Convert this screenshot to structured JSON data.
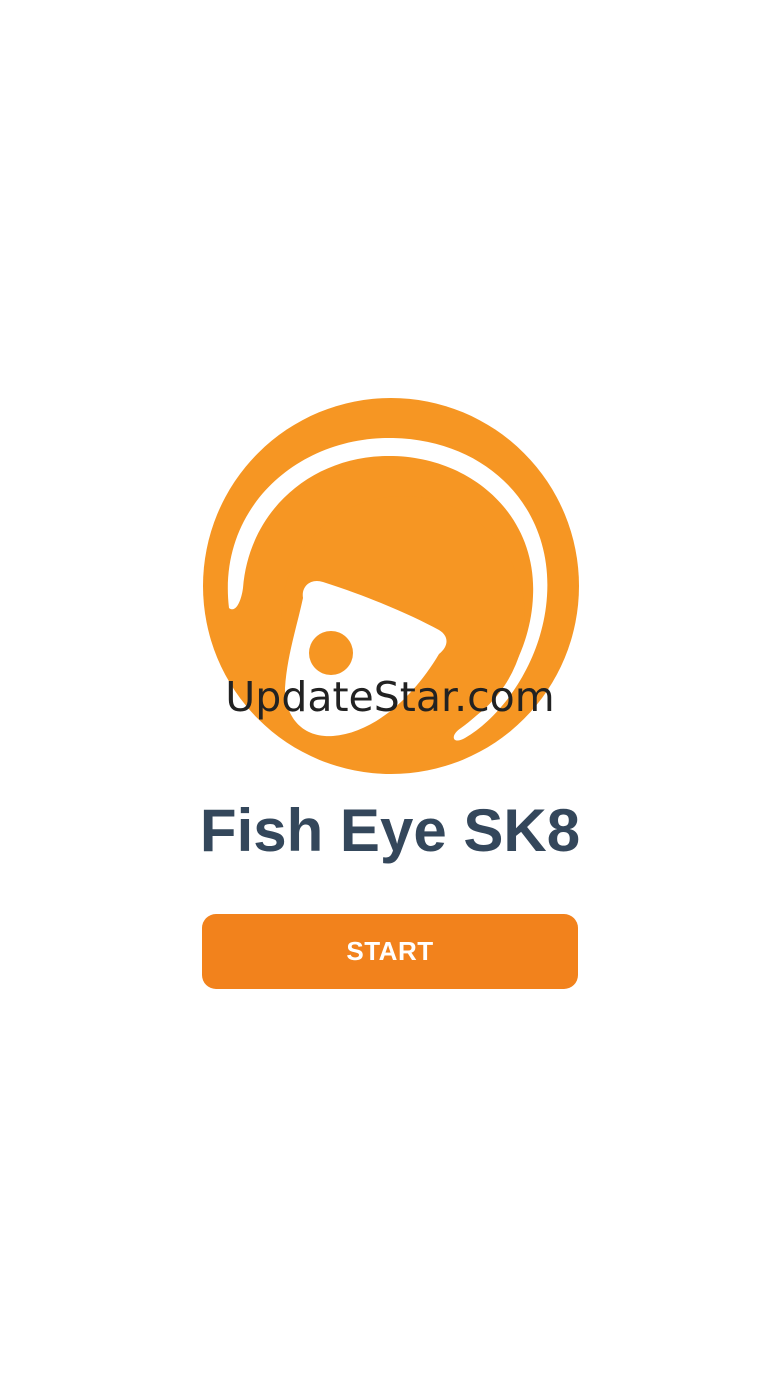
{
  "app": {
    "title": "Fish Eye SK8",
    "start_label": "START",
    "watermark": "UpdateStar.com",
    "logo_icon": "fish-eye-logo-icon"
  },
  "colors": {
    "brand_orange": "#f69623",
    "button_orange": "#f2821c",
    "title_text": "#34475b",
    "background": "#ffffff"
  }
}
